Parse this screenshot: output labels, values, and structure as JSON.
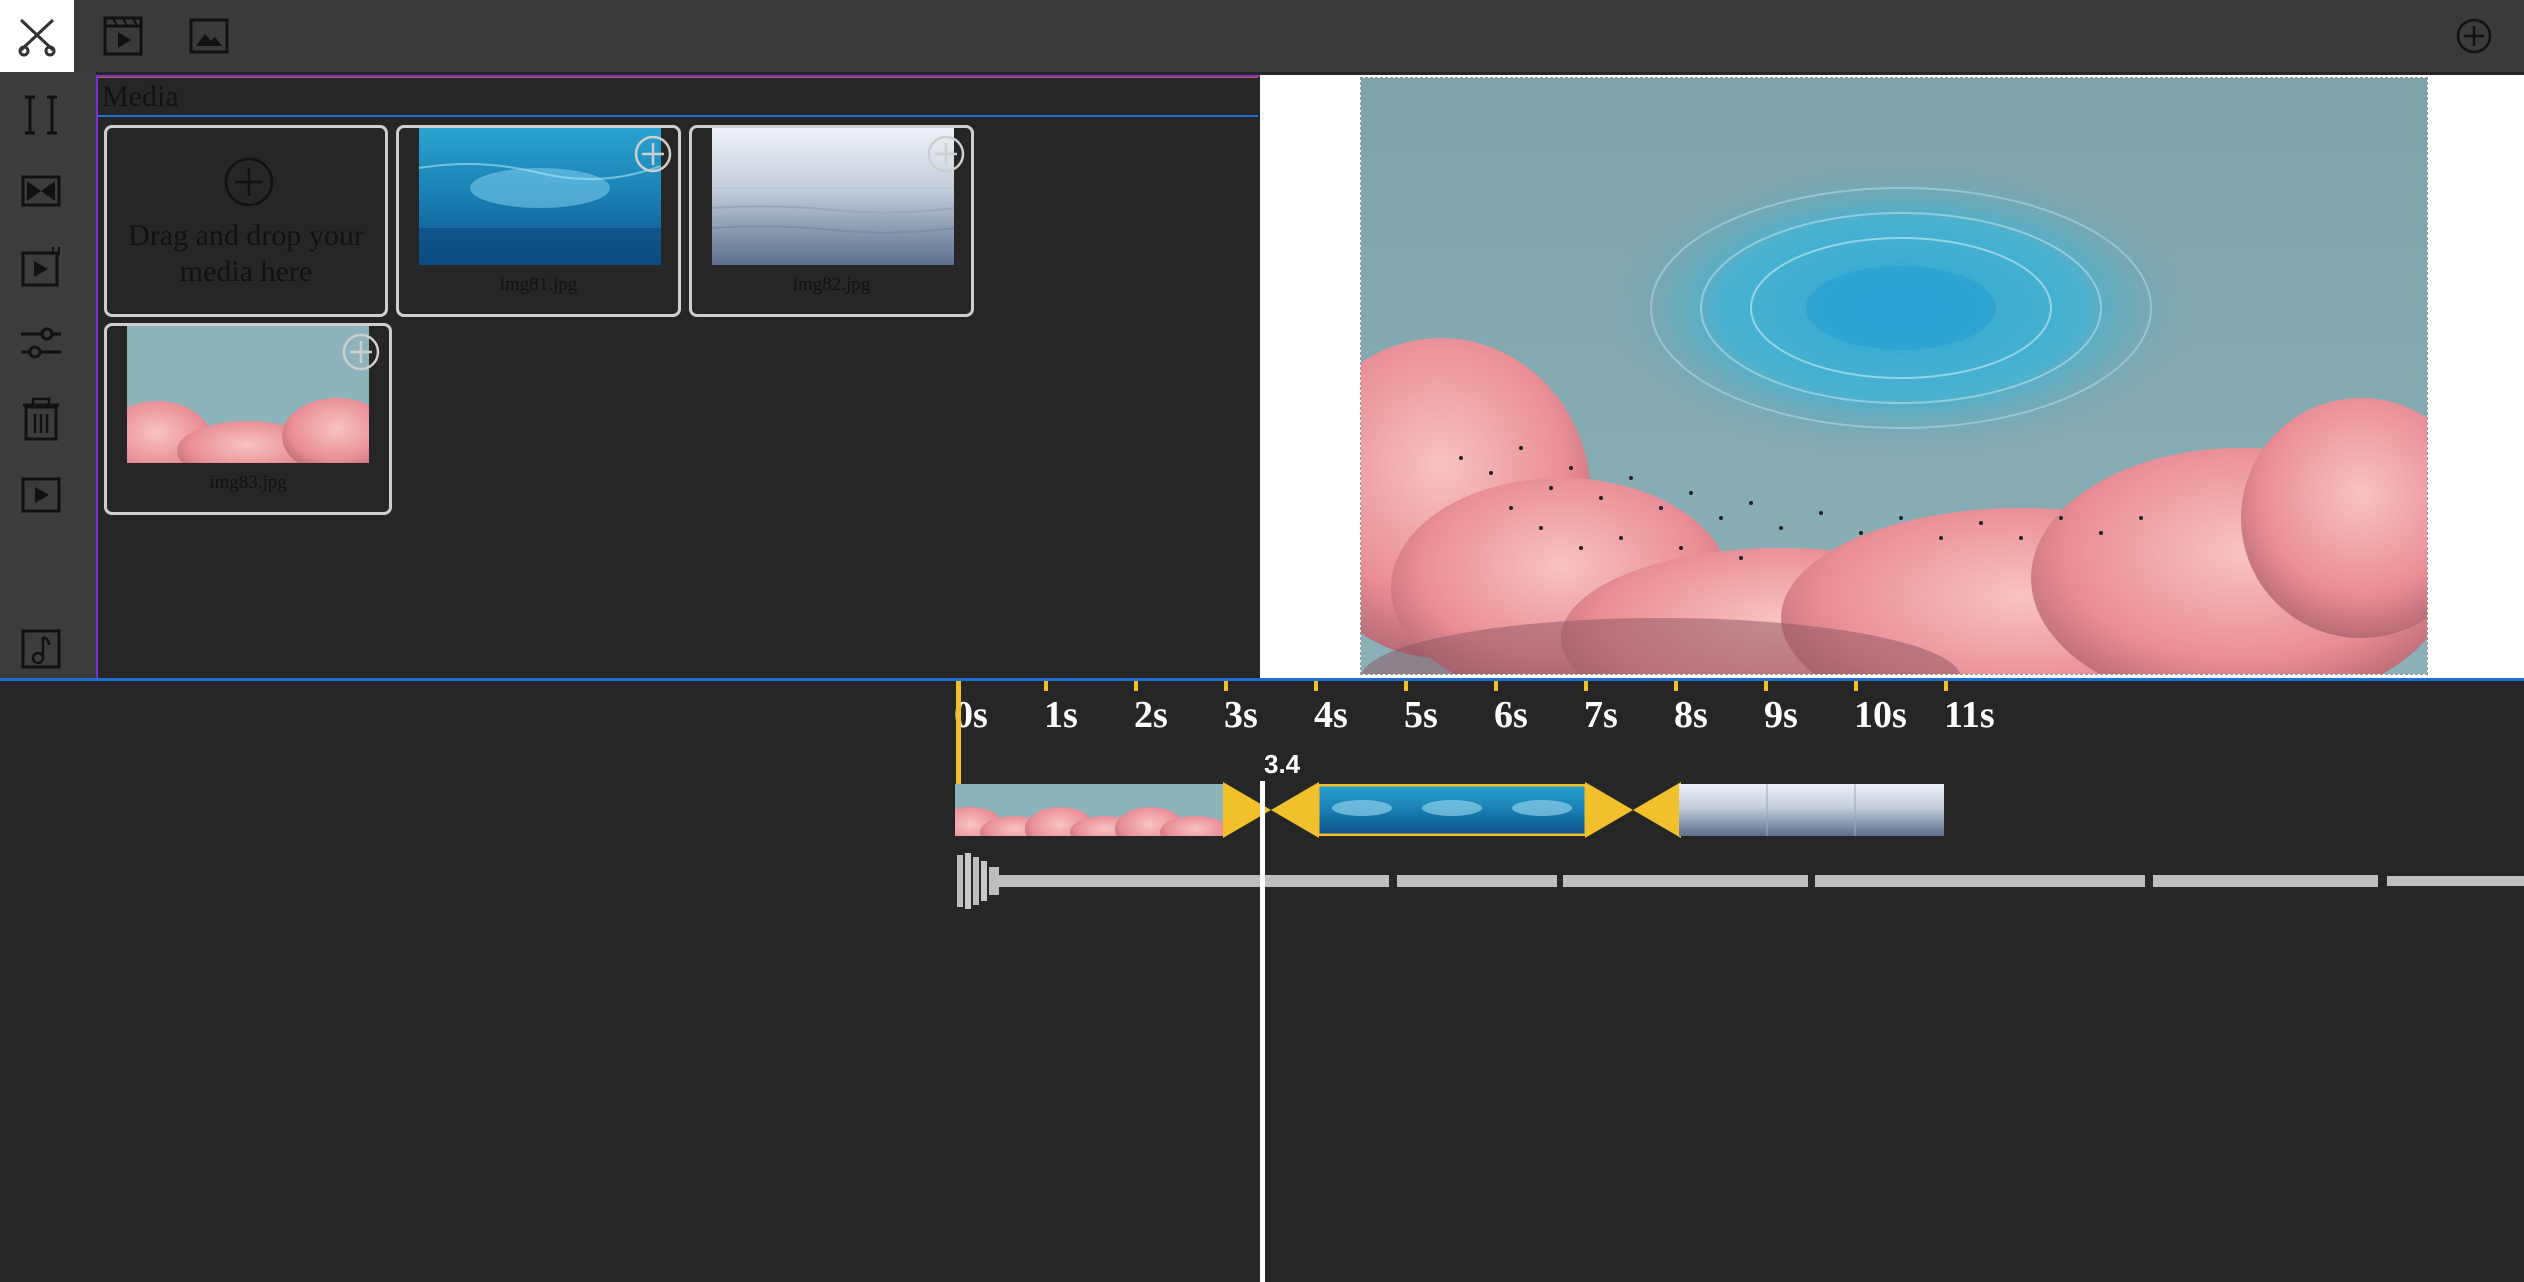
{
  "toolbar": {
    "tools": [
      {
        "name": "scissors-icon",
        "active": true
      },
      {
        "name": "clapperboard-play-icon",
        "active": false
      },
      {
        "name": "image-icon",
        "active": false
      }
    ],
    "add_icon": "plus-circle-icon"
  },
  "sidebar": {
    "items": [
      "split-icon",
      "transition-icon",
      "clip-add-icon",
      "adjust-sliders-icon",
      "trash-icon",
      "play-icon",
      "audio-note-icon"
    ]
  },
  "media": {
    "title": "Media",
    "drop_text": "Drag and drop your media here",
    "items": [
      {
        "filename": "img81.jpg"
      },
      {
        "filename": "img82.jpg"
      },
      {
        "filename": "img83.jpg"
      }
    ]
  },
  "timeline": {
    "ticks": [
      "0s",
      "1s",
      "2s",
      "3s",
      "4s",
      "5s",
      "6s",
      "7s",
      "8s",
      "9s",
      "10s",
      "11s"
    ],
    "playhead_label": "3.4",
    "playhead_time": 3.4,
    "clips": [
      {
        "name": "img83.jpg"
      },
      {
        "name": "img81.jpg",
        "selected": true
      },
      {
        "name": "img82.jpg"
      }
    ]
  },
  "colors": {
    "accent": "#f2c02b",
    "panel_border": "#7b2fd6",
    "blue_line": "#1e6fd1",
    "background": "#262626"
  }
}
